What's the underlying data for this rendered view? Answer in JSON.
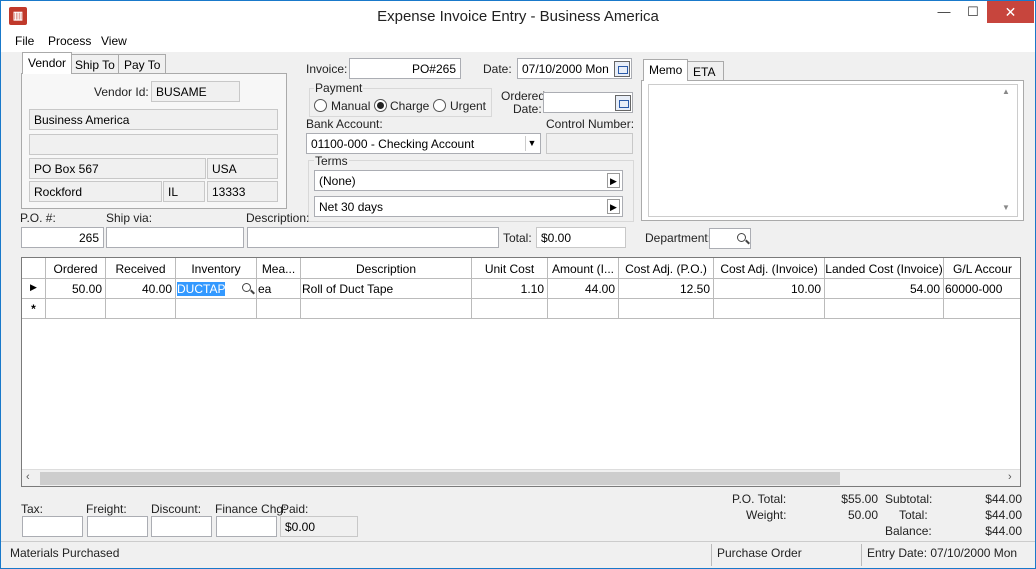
{
  "window": {
    "title": "Expense Invoice Entry - Business America"
  },
  "menu": [
    "File",
    "Process",
    "View"
  ],
  "vendor_tabs": [
    "Vendor",
    "Ship To",
    "Pay To"
  ],
  "vendor": {
    "id_label": "Vendor Id:",
    "id": "BUSAME",
    "name": "Business America",
    "address2": "",
    "address": "PO Box 567",
    "country": "USA",
    "city": "Rockford",
    "state": "IL",
    "zip": "13333"
  },
  "invoice": {
    "invoice_label": "Invoice:",
    "invoice": "PO#265",
    "date_label": "Date:",
    "date": "07/10/2000 Mon",
    "payment_label": "Payment",
    "payment_options": [
      "Manual",
      "Charge",
      "Urgent"
    ],
    "payment_selected": "Charge",
    "ordered_label_1": "Ordered",
    "ordered_label_2": "Date:",
    "ordered_date": "",
    "bank_label": "Bank Account:",
    "bank": "01100-000 - Checking Account",
    "control_label": "Control Number:",
    "control": "",
    "terms_label": "Terms",
    "terms1": "(None)",
    "terms2": "Net  30 days"
  },
  "memo_tabs": [
    "Memo",
    "ETA"
  ],
  "memo": "",
  "po_row": {
    "po_label": "P.O. #:",
    "po": "265",
    "ship_label": "Ship via:",
    "ship": "",
    "desc_label": "Description:",
    "desc": "",
    "total_label": "Total:",
    "total": "$0.00",
    "dept_label": "Department:"
  },
  "grid": {
    "columns": [
      "Ordered",
      "Received",
      "Inventory",
      "Mea...",
      "Description",
      "Unit Cost",
      "Amount (I...",
      "Cost Adj. (P.O.)",
      "Cost Adj. (Invoice)",
      "Landed Cost (Invoice)",
      "G/L Accour"
    ],
    "rows": [
      {
        "ordered": "50.00",
        "received": "40.00",
        "inventory": "DUCTAP",
        "measure": "ea",
        "description": "Roll of Duct Tape",
        "unit_cost": "1.10",
        "amount": "44.00",
        "adj_po": "12.50",
        "adj_inv": "10.00",
        "landed": "54.00",
        "gl": "60000-000"
      }
    ],
    "new_row_marker": "*"
  },
  "footer": {
    "tax_label": "Tax:",
    "tax": "",
    "freight_label": "Freight:",
    "freight": "",
    "discount_label": "Discount:",
    "discount": "",
    "finance_label": "Finance Chg:",
    "finance": "",
    "paid_label": "Paid:",
    "paid": "$0.00",
    "po_total_label": "P.O. Total:",
    "po_total": "$55.00",
    "weight_label": "Weight:",
    "weight": "50.00",
    "subtotal_label": "Subtotal:",
    "subtotal": "$44.00",
    "total_label": "Total:",
    "total": "$44.00",
    "balance_label": "Balance:",
    "balance": "$44.00"
  },
  "status": {
    "left": "Materials Purchased",
    "middle": "Purchase Order",
    "right": "Entry Date: 07/10/2000 Mon"
  },
  "colors": {
    "selection": "#3399ff",
    "close": "#c7453d",
    "border": "#1979ca"
  }
}
